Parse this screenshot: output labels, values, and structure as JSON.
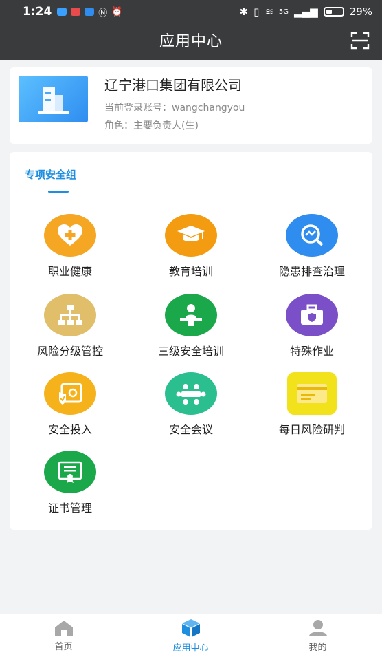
{
  "status_bar": {
    "time": "1:24",
    "network": "5G",
    "battery": "29%"
  },
  "header": {
    "title": "应用中心"
  },
  "company": {
    "name": "辽宁港口集团有限公司",
    "account": "当前登录账号：wangchangyou",
    "role": "角色：主要负责人(生)"
  },
  "group": {
    "tab_label": "专项安全组",
    "items": [
      {
        "label": "职业健康",
        "color": "#f5a623",
        "icon": "heart-plus-icon"
      },
      {
        "label": "教育培训",
        "color": "#f39c12",
        "icon": "graduation-cap-icon"
      },
      {
        "label": "隐患排查治理",
        "color": "#2f8df0",
        "icon": "magnifier-chart-icon"
      },
      {
        "label": "风险分级管控",
        "color": "#e0be6a",
        "icon": "hierarchy-icon"
      },
      {
        "label": "三级安全培训",
        "color": "#1aa84a",
        "icon": "presenter-icon"
      },
      {
        "label": "特殊作业",
        "color": "#7b4fc8",
        "icon": "toolbox-icon"
      },
      {
        "label": "安全投入",
        "color": "#f6b21b",
        "icon": "safe-shield-icon"
      },
      {
        "label": "安全会议",
        "color": "#2bbf8f",
        "icon": "meeting-icon"
      },
      {
        "label": "每日风险研判",
        "color": "#f2c912",
        "icon": "card-icon"
      },
      {
        "label": "证书管理",
        "color": "#1aa84a",
        "icon": "certificate-icon"
      }
    ]
  },
  "bottom_nav": {
    "items": [
      {
        "label": "首页",
        "icon": "home-icon"
      },
      {
        "label": "应用中心",
        "icon": "cube-icon"
      },
      {
        "label": "我的",
        "icon": "user-icon"
      }
    ],
    "active_color": "#1e8fe0"
  }
}
